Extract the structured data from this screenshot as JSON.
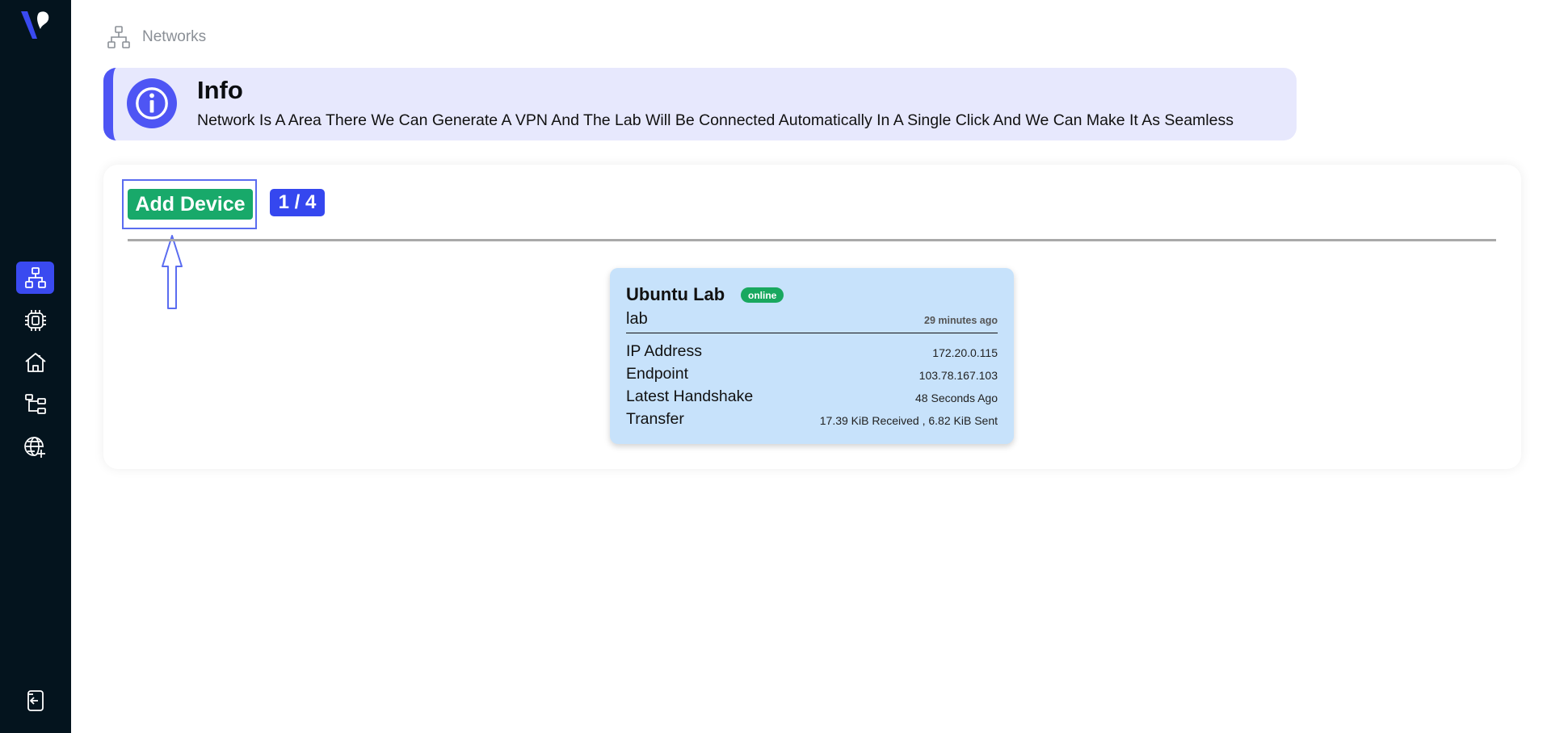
{
  "sidebar": {
    "logo": "vpn-logo",
    "items": [
      {
        "icon": "network-icon",
        "active": true
      },
      {
        "icon": "chip-icon",
        "active": false
      },
      {
        "icon": "home-icon",
        "active": false
      },
      {
        "icon": "tree-icon",
        "active": false
      },
      {
        "icon": "globe-add-icon",
        "active": false
      }
    ],
    "bottom_icon": "logout-icon"
  },
  "breadcrumb": {
    "icon": "network-icon",
    "label": "Networks"
  },
  "info": {
    "title": "Info",
    "text": "Network Is A Area There We Can Generate A VPN And The Lab Will Be Connected Automatically In A Single Click And We Can Make It As Seamless"
  },
  "toolbar": {
    "add_device_label": "Add Device",
    "count": "1 / 4"
  },
  "device": {
    "name": "Ubuntu Lab",
    "status": "online",
    "type": "lab",
    "time": "29 minutes ago",
    "rows": [
      {
        "label": "IP Address",
        "value": "172.20.0.115"
      },
      {
        "label": "Endpoint",
        "value": "103.78.167.103"
      },
      {
        "label": "Latest Handshake",
        "value": "48 Seconds Ago"
      },
      {
        "label": "Transfer",
        "value": "17.39 KiB Received , 6.82 KiB Sent"
      }
    ]
  },
  "colors": {
    "sidebar_bg": "#04141e",
    "accent": "#3a4af0",
    "success": "#18a96a",
    "info_bg": "#e7e8fd",
    "card_bg": "#c7e2fb"
  }
}
